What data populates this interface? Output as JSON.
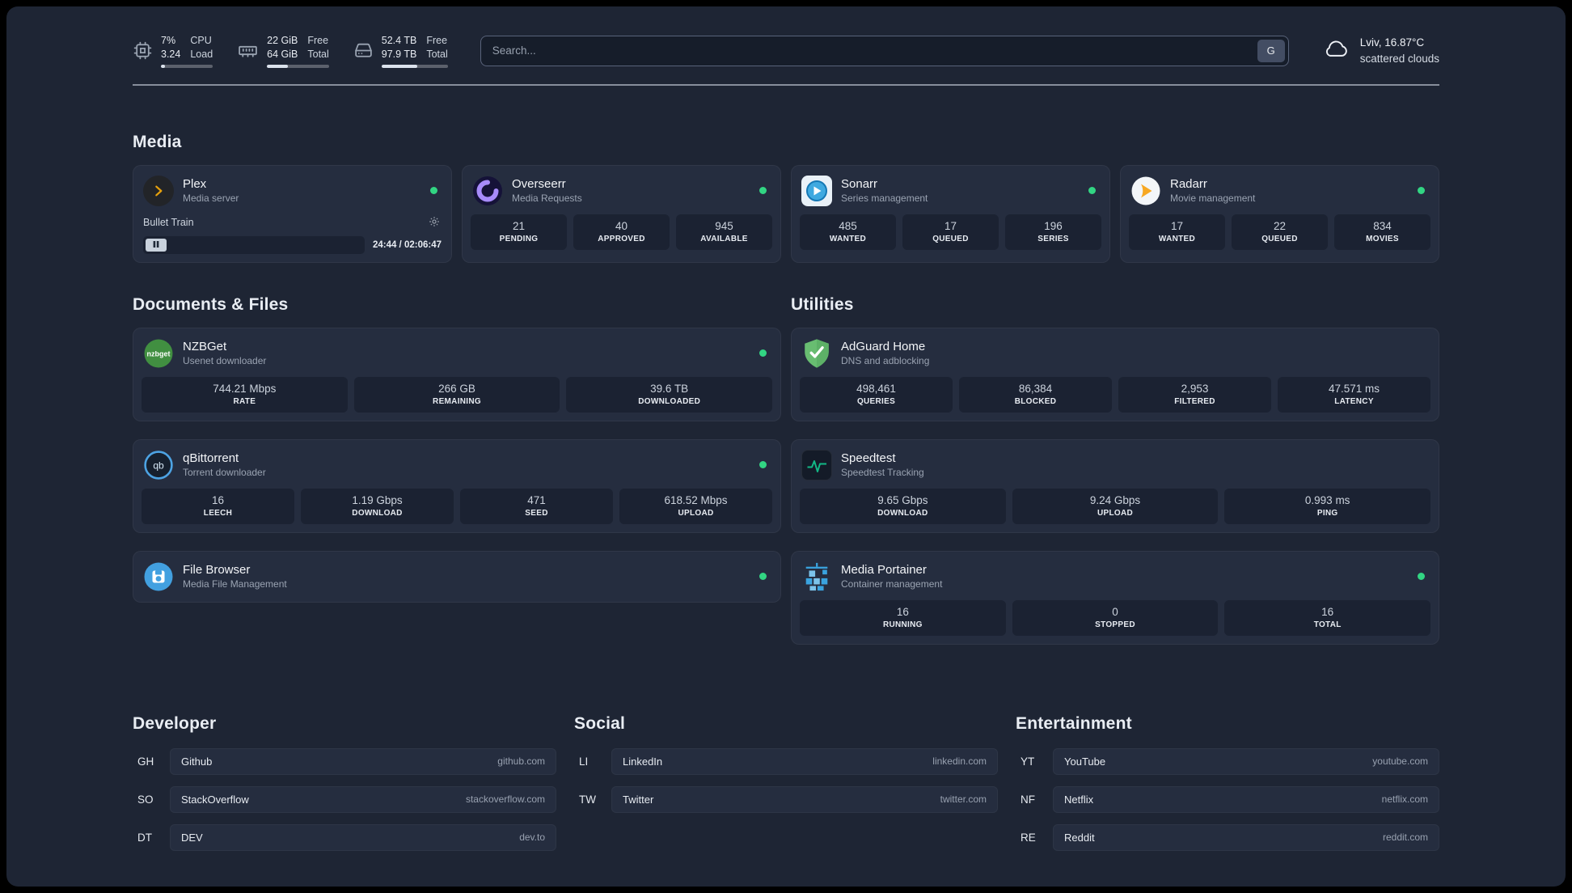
{
  "colors": {
    "background": "#1e2534",
    "card": "#252d3f",
    "stat_block": "#1b2232",
    "status_online": "#32d583",
    "plex_accent": "#e5a00d"
  },
  "topbar": {
    "cpu": {
      "icon": "cpu-icon",
      "value_top": "7%",
      "value_bottom": "3.24",
      "label_top": "CPU",
      "label_bottom": "Load"
    },
    "ram": {
      "icon": "memory-icon",
      "value_top": "22 GiB",
      "value_bottom": "64 GiB",
      "label_top": "Free",
      "label_bottom": "Total"
    },
    "disk": {
      "icon": "hard-drive-icon",
      "value_top": "52.4 TB",
      "value_bottom": "97.9 TB",
      "label_top": "Free",
      "label_bottom": "Total"
    },
    "search": {
      "placeholder": "Search...",
      "provider_button": "G"
    },
    "weather": {
      "icon": "cloud-icon",
      "location": "Lviv, 16.87°C",
      "condition": "scattered clouds"
    }
  },
  "media": {
    "title": "Media",
    "plex": {
      "name": "Plex",
      "desc": "Media server",
      "now_playing": "Bullet Train",
      "time": "24:44 / 02:06:47"
    },
    "overseerr": {
      "name": "Overseerr",
      "desc": "Media Requests",
      "stats": [
        {
          "value": "21",
          "label": "PENDING"
        },
        {
          "value": "40",
          "label": "APPROVED"
        },
        {
          "value": "945",
          "label": "AVAILABLE"
        }
      ]
    },
    "sonarr": {
      "name": "Sonarr",
      "desc": "Series management",
      "stats": [
        {
          "value": "485",
          "label": "WANTED"
        },
        {
          "value": "17",
          "label": "QUEUED"
        },
        {
          "value": "196",
          "label": "SERIES"
        }
      ]
    },
    "radarr": {
      "name": "Radarr",
      "desc": "Movie management",
      "stats": [
        {
          "value": "17",
          "label": "WANTED"
        },
        {
          "value": "22",
          "label": "QUEUED"
        },
        {
          "value": "834",
          "label": "MOVIES"
        }
      ]
    }
  },
  "documents": {
    "title": "Documents & Files",
    "nzbget": {
      "name": "NZBGet",
      "desc": "Usenet downloader",
      "stats": [
        {
          "value": "744.21 Mbps",
          "label": "RATE"
        },
        {
          "value": "266 GB",
          "label": "REMAINING"
        },
        {
          "value": "39.6 TB",
          "label": "DOWNLOADED"
        }
      ]
    },
    "qbittorrent": {
      "name": "qBittorrent",
      "desc": "Torrent downloader",
      "stats": [
        {
          "value": "16",
          "label": "LEECH"
        },
        {
          "value": "1.19 Gbps",
          "label": "DOWNLOAD"
        },
        {
          "value": "471",
          "label": "SEED"
        },
        {
          "value": "618.52 Mbps",
          "label": "UPLOAD"
        }
      ]
    },
    "filebrowser": {
      "name": "File Browser",
      "desc": "Media File Management"
    }
  },
  "utilities": {
    "title": "Utilities",
    "adguard": {
      "name": "AdGuard Home",
      "desc": "DNS and adblocking",
      "stats": [
        {
          "value": "498,461",
          "label": "QUERIES"
        },
        {
          "value": "86,384",
          "label": "BLOCKED"
        },
        {
          "value": "2,953",
          "label": "FILTERED"
        },
        {
          "value": "47.571 ms",
          "label": "LATENCY"
        }
      ]
    },
    "speedtest": {
      "name": "Speedtest",
      "desc": "Speedtest Tracking",
      "stats": [
        {
          "value": "9.65 Gbps",
          "label": "DOWNLOAD"
        },
        {
          "value": "9.24 Gbps",
          "label": "UPLOAD"
        },
        {
          "value": "0.993 ms",
          "label": "PING"
        }
      ]
    },
    "portainer": {
      "name": "Media Portainer",
      "desc": "Container management",
      "stats": [
        {
          "value": "16",
          "label": "RUNNING"
        },
        {
          "value": "0",
          "label": "STOPPED"
        },
        {
          "value": "16",
          "label": "TOTAL"
        }
      ]
    }
  },
  "bookmarks": {
    "developer": {
      "title": "Developer",
      "items": [
        {
          "abbr": "GH",
          "name": "Github",
          "url": "github.com"
        },
        {
          "abbr": "SO",
          "name": "StackOverflow",
          "url": "stackoverflow.com"
        },
        {
          "abbr": "DT",
          "name": "DEV",
          "url": "dev.to"
        }
      ]
    },
    "social": {
      "title": "Social",
      "items": [
        {
          "abbr": "LI",
          "name": "LinkedIn",
          "url": "linkedin.com"
        },
        {
          "abbr": "TW",
          "name": "Twitter",
          "url": "twitter.com"
        }
      ]
    },
    "entertainment": {
      "title": "Entertainment",
      "items": [
        {
          "abbr": "YT",
          "name": "YouTube",
          "url": "youtube.com"
        },
        {
          "abbr": "NF",
          "name": "Netflix",
          "url": "netflix.com"
        },
        {
          "abbr": "RE",
          "name": "Reddit",
          "url": "reddit.com"
        }
      ]
    }
  },
  "icon_text": {
    "nzbget": "nzbget",
    "qbittorrent": "qb"
  }
}
